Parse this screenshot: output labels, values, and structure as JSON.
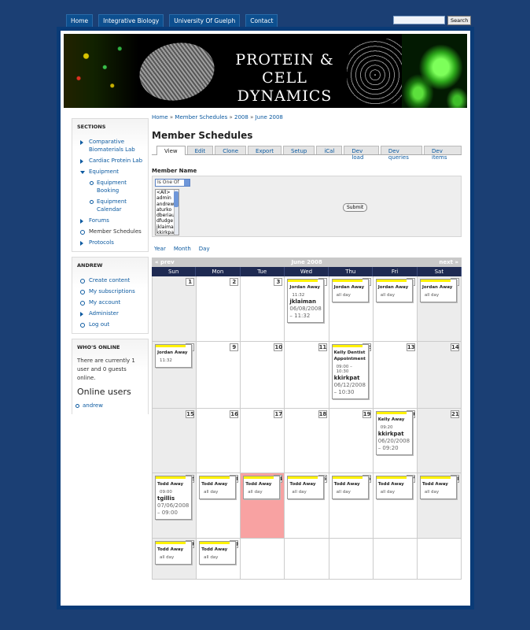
{
  "topnav": {
    "items": [
      "Home",
      "Integrative Biology",
      "University Of Guelph",
      "Contact"
    ],
    "search_button": "Search"
  },
  "banner": {
    "title_line1": "Protein & cell",
    "title_line2": "Dynamics"
  },
  "breadcrumb": [
    "Home",
    "Member Schedules",
    "2008",
    "June 2008"
  ],
  "page_title": "Member Schedules",
  "tabs": [
    "View",
    "Edit",
    "Clone",
    "Export",
    "Setup",
    "iCal",
    "Dev load",
    "Dev queries",
    "Dev items"
  ],
  "filter": {
    "label": "Member Name",
    "operator": "Is One Of",
    "options": [
      "<All>",
      "admin",
      "andrew",
      "aturko",
      "dberiaul",
      "dfudge",
      "jklaiman",
      "kkirkpat"
    ],
    "submit": "Submit"
  },
  "views": [
    "Year",
    "Month",
    "Day"
  ],
  "calendar": {
    "prev": "« prev",
    "month": "June 2008",
    "next": "next »",
    "daynames": [
      "Sun",
      "Mon",
      "Tue",
      "Wed",
      "Thu",
      "Fri",
      "Sat"
    ],
    "weeks": [
      [
        {
          "day": "1"
        },
        {
          "day": "2"
        },
        {
          "day": "3"
        },
        {
          "day": "4",
          "event": {
            "title": "Jordan Away",
            "time": "11:32",
            "user": "jklaiman",
            "date": "06/08/2008 – 11:32"
          }
        },
        {
          "day": "5",
          "event": {
            "title": "Jordan Away",
            "time": "all day"
          }
        },
        {
          "day": "6",
          "event": {
            "title": "Jordan Away",
            "time": "all day"
          }
        },
        {
          "day": "7",
          "event": {
            "title": "Jordan Away",
            "time": "all day"
          }
        }
      ],
      [
        {
          "day": "8",
          "event": {
            "title": "Jordan Away",
            "time": "11:32"
          }
        },
        {
          "day": "9"
        },
        {
          "day": "10"
        },
        {
          "day": "11"
        },
        {
          "day": "12",
          "event": {
            "title": "Kelly Dentist Appointment",
            "time": "09:00 – 10:30",
            "user": "kkirkpat",
            "date": "06/12/2008 – 10:30"
          }
        },
        {
          "day": "13"
        },
        {
          "day": "14"
        }
      ],
      [
        {
          "day": "15"
        },
        {
          "day": "16"
        },
        {
          "day": "17"
        },
        {
          "day": "18"
        },
        {
          "day": "19"
        },
        {
          "day": "20",
          "event": {
            "title": "Kelly Away",
            "time": "09:20",
            "user": "kkirkpat",
            "date": "06/20/2008 – 09:20"
          }
        },
        {
          "day": "21"
        }
      ],
      [
        {
          "day": "22",
          "event": {
            "title": "Todd Away",
            "time": "09:00",
            "user": "tgillis",
            "date": "07/06/2008 – 09:00"
          }
        },
        {
          "day": "23",
          "event": {
            "title": "Todd Away",
            "time": "all day"
          }
        },
        {
          "day": "24",
          "event": {
            "title": "Todd Away",
            "time": "all day"
          }
        },
        {
          "day": "25",
          "event": {
            "title": "Todd Away",
            "time": "all day"
          }
        },
        {
          "day": "26",
          "event": {
            "title": "Todd Away",
            "time": "all day"
          }
        },
        {
          "day": "27",
          "event": {
            "title": "Todd Away",
            "time": "all day"
          }
        },
        {
          "day": "28",
          "event": {
            "title": "Todd Away",
            "time": "all day"
          }
        }
      ],
      [
        {
          "day": "29",
          "event": {
            "title": "Todd Away",
            "time": "all day"
          }
        },
        {
          "day": "30",
          "event": {
            "title": "Todd Away",
            "time": "all day"
          }
        },
        {
          "day": ""
        },
        {
          "day": ""
        },
        {
          "day": ""
        },
        {
          "day": ""
        },
        {
          "day": ""
        }
      ]
    ]
  },
  "sidebar": {
    "sections_title": "SECTIONS",
    "sections": [
      {
        "label": "Comparative Biomaterials Lab"
      },
      {
        "label": "Cardiac Protein Lab"
      },
      {
        "label": "Equipment",
        "children": [
          "Equipment Booking",
          "Equipment Calendar"
        ]
      },
      {
        "label": "Forums"
      },
      {
        "label": "Member Schedules"
      },
      {
        "label": "Protocols"
      }
    ],
    "user_title": "ANDREW",
    "user_links": [
      "Create content",
      "My subscriptions",
      "My account",
      "Administer",
      "Log out"
    ],
    "online_title": "WHO'S ONLINE",
    "online_text": "There are currently 1 user and 0 guests online.",
    "online_users_heading": "Online users",
    "online_users": [
      "andrew"
    ]
  },
  "colors": {
    "background": "#1b3f74",
    "link": "#0c5aa0",
    "today": "#f8a2a2",
    "event_bar": "#fff200"
  }
}
